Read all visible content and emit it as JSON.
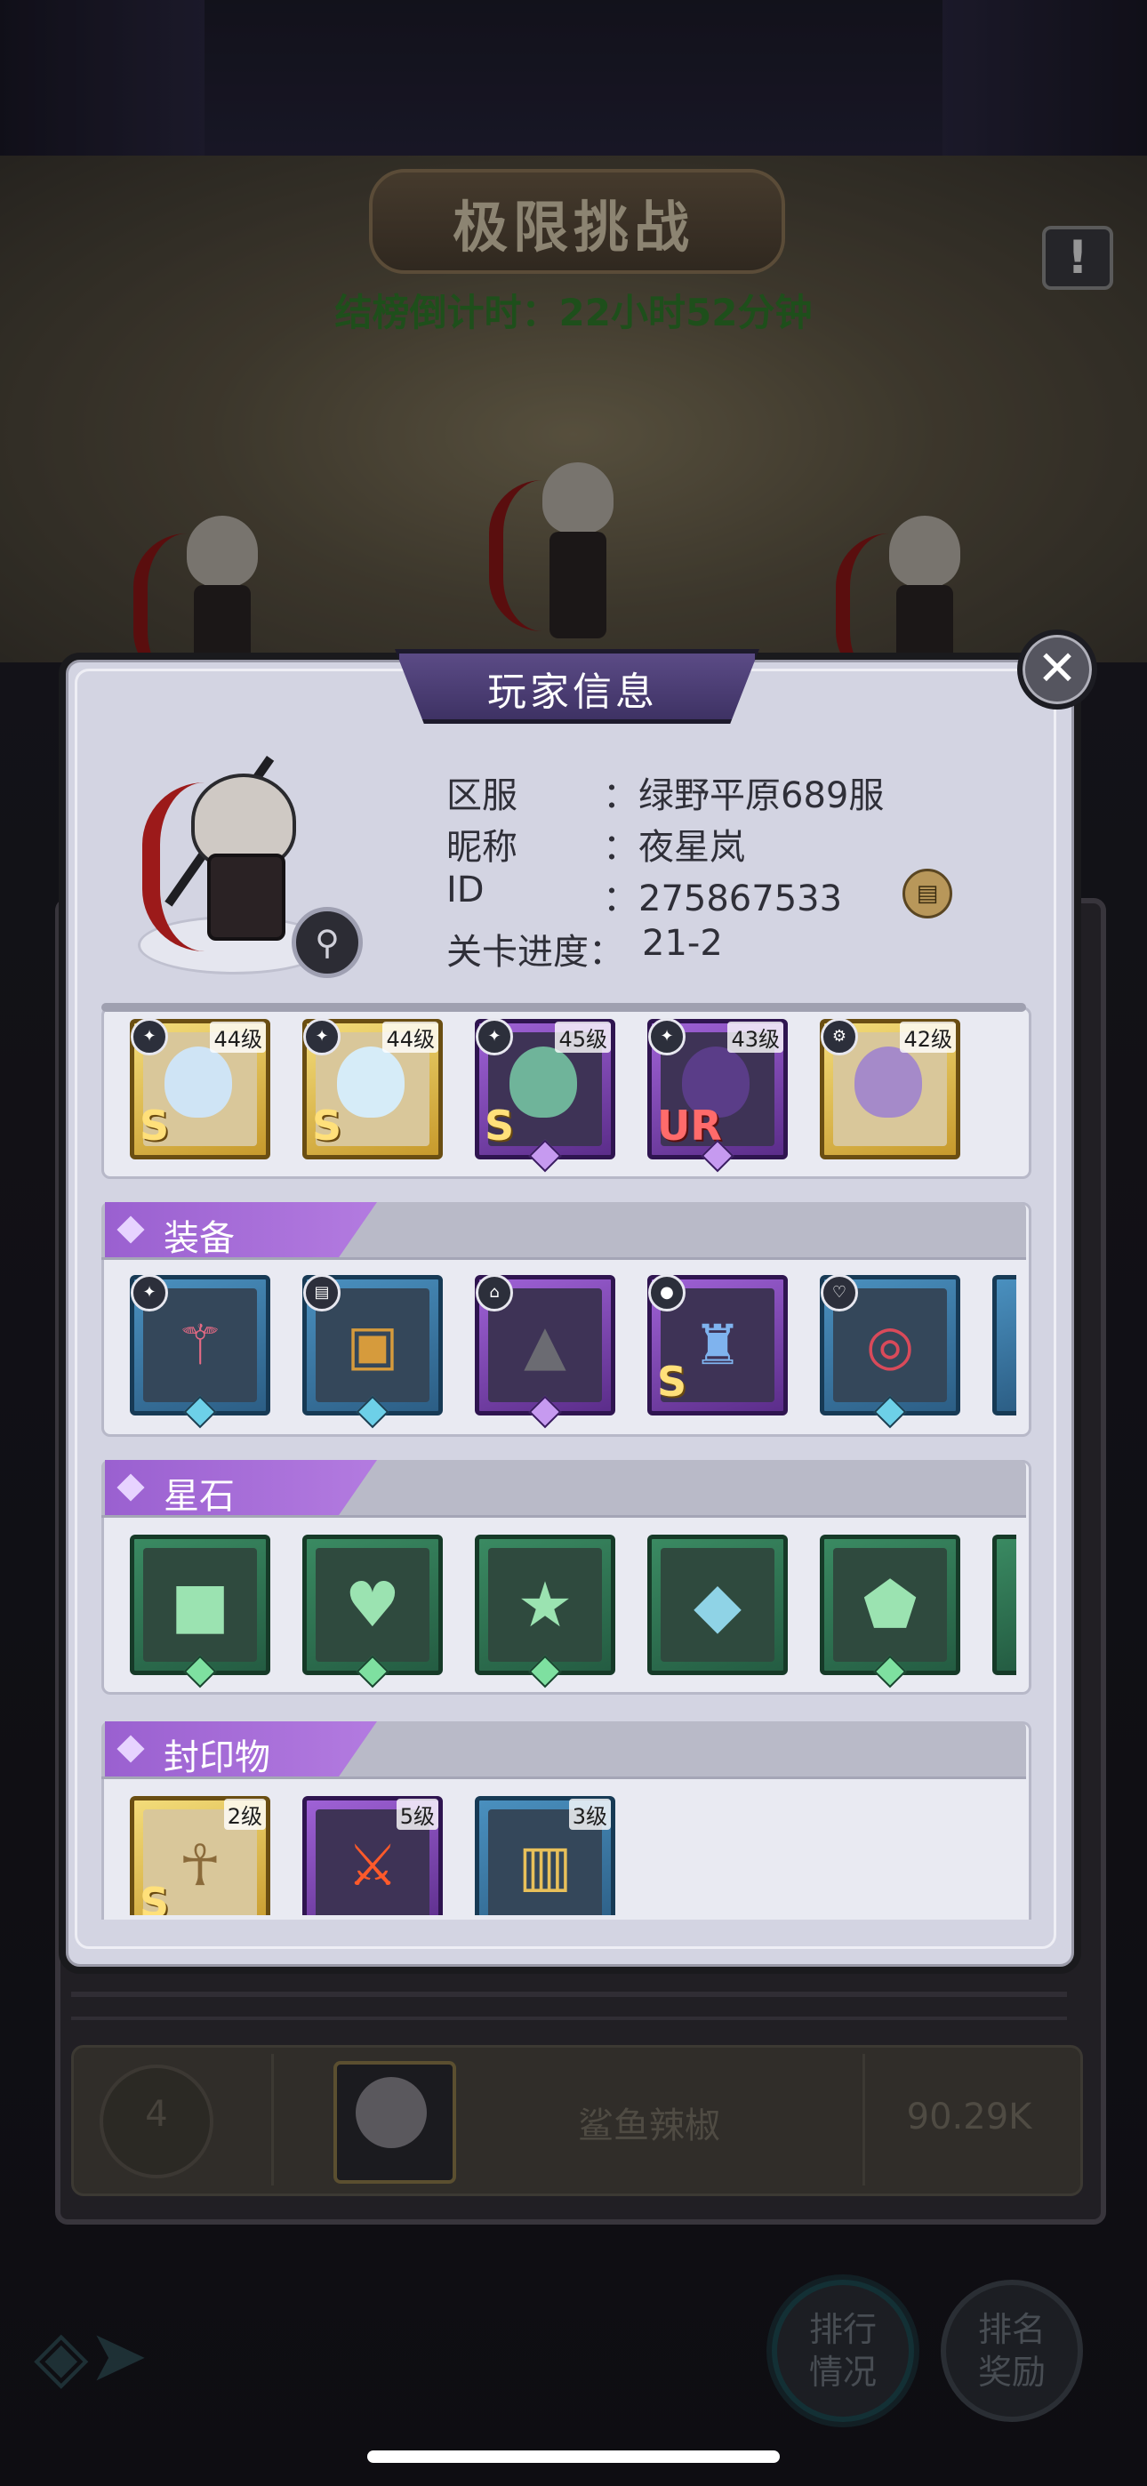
{
  "screen": {
    "title": "极限挑战",
    "countdown": "结榜倒计时：22小时52分钟",
    "warning_icon": "!"
  },
  "background_rank_row": {
    "rank": "4",
    "player_name": "鲨鱼辣椒",
    "power": "90.29K"
  },
  "bottom_nav": {
    "ranking_button": "排行\n情况",
    "reward_button": "排名\n奖励"
  },
  "modal": {
    "title": "玩家信息",
    "close_icon": "✕",
    "info": [
      {
        "label": "区服",
        "value": "：绿野平原689服"
      },
      {
        "label": "昵称",
        "value": "：夜星岚"
      },
      {
        "label": "ID",
        "value": "：275867533"
      },
      {
        "label": "关卡进度：",
        "value": "21-2"
      }
    ]
  },
  "heroes": [
    {
      "level": "44级",
      "rarity": "S",
      "frame": "gold"
    },
    {
      "level": "44级",
      "rarity": "S",
      "frame": "gold"
    },
    {
      "level": "45级",
      "rarity": "S",
      "frame": "purple"
    },
    {
      "level": "43级",
      "rarity": "UR",
      "frame": "purple"
    },
    {
      "level": "42级",
      "rarity": "",
      "frame": "gold"
    }
  ],
  "sections": {
    "equipment": "装备",
    "star_stones": "星石",
    "seals": "封印物"
  },
  "equipment": [
    {
      "icon": "heart-wand-icon",
      "frame": "blue"
    },
    {
      "icon": "spellbook-icon",
      "frame": "blue"
    },
    {
      "icon": "witch-hat-icon",
      "frame": "purple"
    },
    {
      "icon": "cape-icon",
      "frame": "purple",
      "rarity": "S"
    },
    {
      "icon": "ruby-ring-icon",
      "frame": "blue"
    }
  ],
  "star_stones": [
    {
      "icon": "square-gem-icon"
    },
    {
      "icon": "heart-gem-icon"
    },
    {
      "icon": "star-gem-icon"
    },
    {
      "icon": "diamond-gem-icon"
    },
    {
      "icon": "shield-gem-icon"
    }
  ],
  "seals": [
    {
      "level": "2级",
      "rarity": "S",
      "frame": "gold",
      "icon": "puppet-doll-icon"
    },
    {
      "level": "5级",
      "rarity": "",
      "frame": "purple",
      "icon": "flame-sword-icon"
    },
    {
      "level": "3级",
      "rarity": "",
      "frame": "blue",
      "icon": "golden-book-icon"
    }
  ],
  "colors": {
    "accent_purple": "#9a60d0",
    "countdown_green": "#2f7a2a",
    "panel_bg": "#d3d4e2"
  }
}
